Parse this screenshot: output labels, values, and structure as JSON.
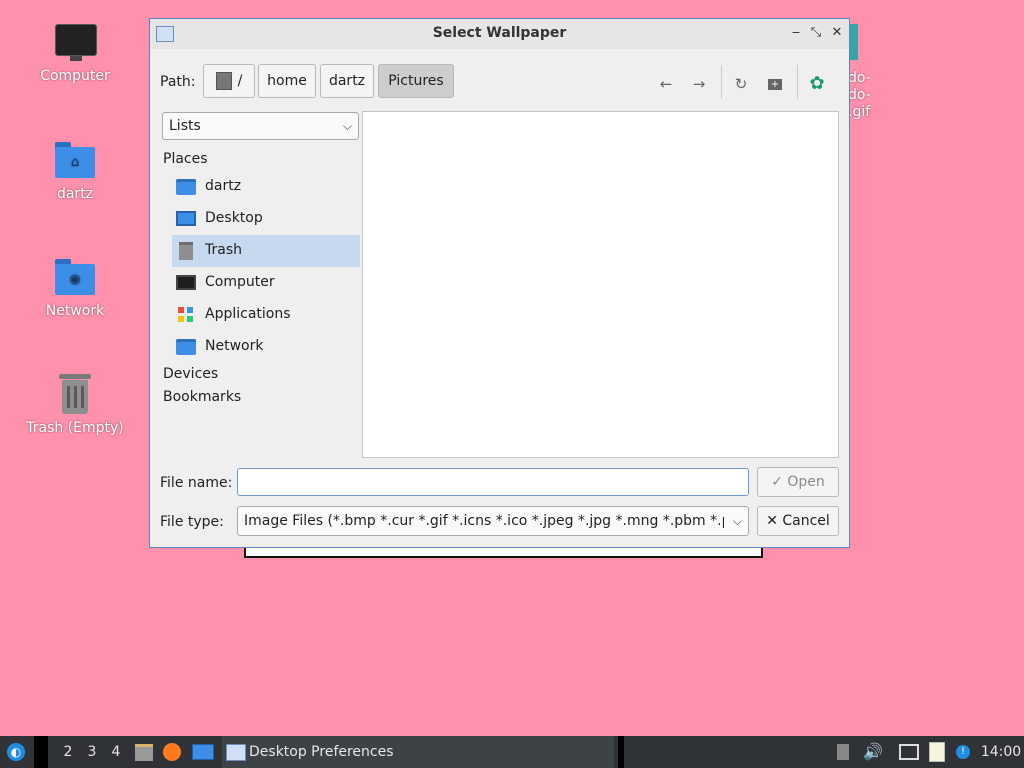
{
  "desktop": {
    "icons": [
      {
        "label": "Computer",
        "icon": "computer-icon"
      },
      {
        "label": "dartz",
        "icon": "home-folder-icon"
      },
      {
        "label": "Network",
        "icon": "network-folder-icon"
      },
      {
        "label": "Trash (Empty)",
        "icon": "trash-icon"
      }
    ],
    "partial_label_lines": [
      "do-",
      "do-",
      ".gif"
    ]
  },
  "dialog": {
    "title": "Select Wallpaper",
    "window_buttons": {
      "minimize": "‒",
      "maximize": "⤡",
      "close": "✕"
    },
    "path_label": "Path:",
    "path_segments": [
      "/",
      "home",
      "dartz",
      "Pictures"
    ],
    "active_segment": "Pictures",
    "toolbar_icons": [
      "back-arrow-icon",
      "forward-arrow-icon",
      "reload-icon",
      "new-folder-icon",
      "settings-icon"
    ],
    "view_mode": "Lists",
    "sidebar": {
      "places_header": "Places",
      "places": [
        {
          "label": "dartz",
          "icon": "home-folder-icon"
        },
        {
          "label": "Desktop",
          "icon": "desktop-icon"
        },
        {
          "label": "Trash",
          "icon": "trash-icon",
          "selected": true
        },
        {
          "label": "Computer",
          "icon": "computer-icon"
        },
        {
          "label": "Applications",
          "icon": "applications-icon"
        },
        {
          "label": "Network",
          "icon": "network-folder-icon"
        }
      ],
      "devices_header": "Devices",
      "bookmarks_header": "Bookmarks"
    },
    "file_name_label": "File name:",
    "file_name_value": "",
    "file_type_label": "File type:",
    "file_type_value": "Image Files (*.bmp *.cur *.gif *.icns *.ico *.jpeg *.jpg *.mng *.pbm *.pgm",
    "open_button": "Open",
    "cancel_button": "Cancel"
  },
  "taskbar": {
    "workspaces": [
      "2",
      "3",
      "4"
    ],
    "window_title": "Desktop Preferences",
    "clock": "14:00"
  },
  "colors": {
    "desktop_bg": "#ff91ad",
    "selection": "#c6d9ee",
    "taskbar_bg": "#2f3337",
    "folder_blue": "#3d8ee6"
  }
}
